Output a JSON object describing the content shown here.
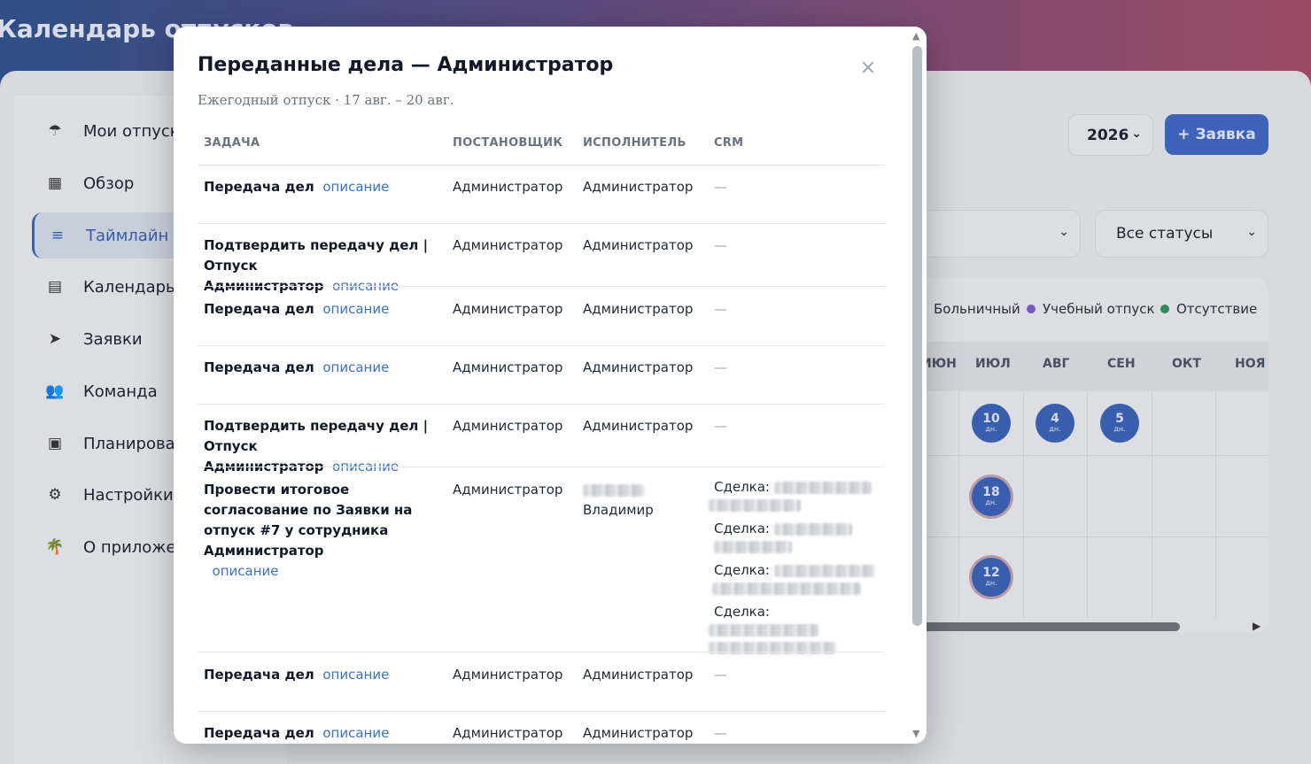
{
  "app": {
    "title": "Календарь отпусков",
    "sidebar": [
      {
        "icon": "umbrella-icon",
        "glyph": "☂",
        "label": "Мои отпуска"
      },
      {
        "icon": "grid-icon",
        "glyph": "▦",
        "label": "Обзор"
      },
      {
        "icon": "list-icon",
        "glyph": "≡",
        "label": "Таймлайн",
        "active": true
      },
      {
        "icon": "calendar-icon",
        "glyph": "▤",
        "label": "Календарь"
      },
      {
        "icon": "send-icon",
        "glyph": "➤",
        "label": "Заявки"
      },
      {
        "icon": "team-icon",
        "glyph": "👥",
        "label": "Команда"
      },
      {
        "icon": "planning-icon",
        "glyph": "▣",
        "label": "Планирование"
      },
      {
        "icon": "gear-icon",
        "glyph": "⚙",
        "label": "Настройки"
      },
      {
        "icon": "palm-icon",
        "glyph": "🌴",
        "label": "О приложении"
      }
    ],
    "year": "2026",
    "new_request": "+ Заявка",
    "status_filter": "Все статусы",
    "legend": [
      {
        "label": "Больничный",
        "color": "#c99a62"
      },
      {
        "label": "Учебный отпуск",
        "color": "#7a55c9"
      },
      {
        "label": "Отсутствие",
        "color": "#2e8a5a"
      }
    ],
    "months": [
      "ИЮН",
      "ИЮЛ",
      "АВГ",
      "СЕН",
      "ОКТ",
      "НОЯ"
    ],
    "bubbles": [
      {
        "value": "10",
        "unit": "дн."
      },
      {
        "value": "4",
        "unit": "дн."
      },
      {
        "value": "5",
        "unit": "дн."
      },
      {
        "value": "18",
        "unit": "дн."
      },
      {
        "value": "12",
        "unit": "дн."
      }
    ]
  },
  "modal": {
    "title": "Переданные дела — Администратор",
    "subtitle": "Ежегодный отпуск · 17 авг. – 20 авг.",
    "close": "×",
    "columns": [
      "ЗАДАЧА",
      "ПОСТАНОВЩИК",
      "ИСПОЛНИТЕЛЬ",
      "CRM"
    ],
    "link_label": "описание",
    "rows": [
      {
        "task": "Передача дел",
        "author": "Администратор",
        "executor": "Администратор",
        "crm": "—"
      },
      {
        "task": "Подтвердить передачу дел | Отпуск Администратор",
        "author": "Администратор",
        "executor": "Администратор",
        "crm": "—"
      },
      {
        "task": "Передача дел",
        "author": "Администратор",
        "executor": "Администратор",
        "crm": "—"
      },
      {
        "task": "Передача дел",
        "author": "Администратор",
        "executor": "Администратор",
        "crm": "—"
      },
      {
        "task": "Подтвердить передачу дел | Отпуск Администратор",
        "author": "Администратор",
        "executor": "Администратор",
        "crm": "—"
      },
      {
        "task": "Провести итоговое согласование по Заявки на отпуск #7 у сотрудника Администратор",
        "author": "Администратор",
        "executor": "Владимир",
        "crm_label": "Сделка:"
      },
      {
        "task": "Передача дел",
        "author": "Администратор",
        "executor": "Администратор",
        "crm": "—"
      },
      {
        "task": "Передача дел",
        "author": "Администратор",
        "executor": "Администратор",
        "crm": "—"
      }
    ]
  }
}
